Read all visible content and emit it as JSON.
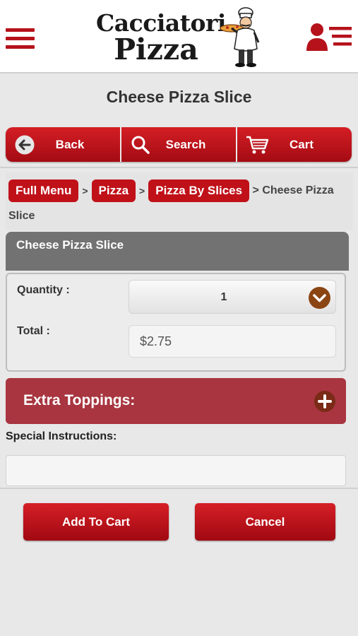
{
  "header": {
    "logo_line1": "Cacciatori",
    "logo_line2": "Pizza",
    "menu_icon": "hamburger-menu-icon",
    "user_icon": "user-list-icon"
  },
  "page": {
    "title": "Cheese Pizza Slice"
  },
  "nav": {
    "back_label": "Back",
    "search_label": "Search",
    "cart_label": "Cart"
  },
  "breadcrumb": {
    "items": [
      "Full Menu",
      "Pizza",
      "Pizza By Slices"
    ],
    "separator": ">",
    "current": "> Cheese Pizza Slice"
  },
  "product": {
    "name": "Cheese Pizza Slice",
    "quantity_label": "Quantity :",
    "quantity_value": "1",
    "total_label": "Total :",
    "total_value": "$2.75"
  },
  "toppings": {
    "label": "Extra Toppings:"
  },
  "instructions": {
    "label": "Special Instructions:",
    "value": ""
  },
  "actions": {
    "add_label": "Add To Cart",
    "cancel_label": "Cancel"
  },
  "colors": {
    "brand_red": "#c01119",
    "toppings_bar": "#a83540",
    "panel_header": "#727272",
    "dropdown_arrow": "#8b4513"
  }
}
